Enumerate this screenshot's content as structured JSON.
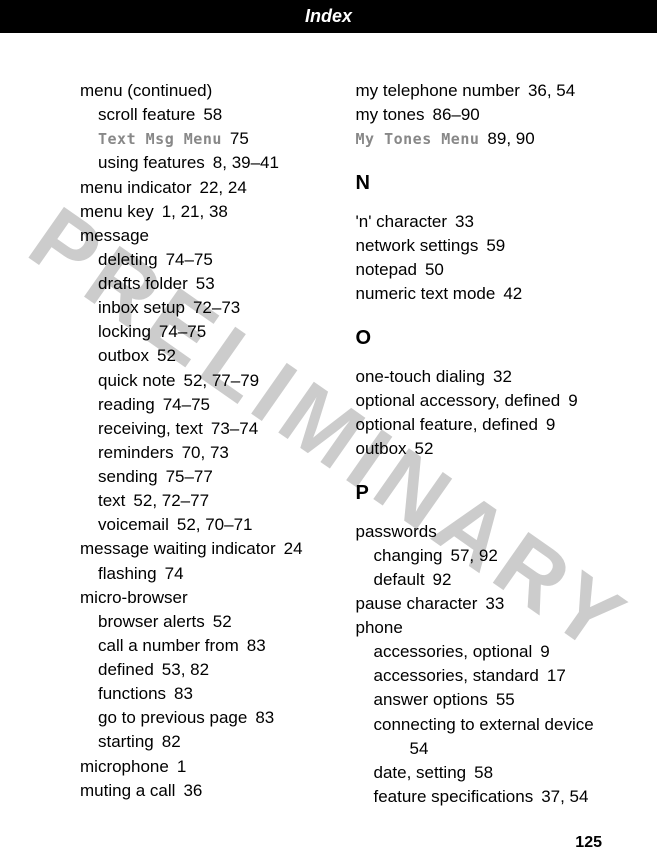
{
  "header": "Index",
  "watermark": "PRELIMINARY",
  "pageNumber": "125",
  "left": [
    {
      "text": "menu (continued)",
      "cls": ""
    },
    {
      "text": "scroll feature",
      "pages": "58",
      "cls": "sub"
    },
    {
      "special": "menu",
      "text": "Text Msg Menu",
      "pages": "75",
      "cls": "sub"
    },
    {
      "text": "using features",
      "pages": "8, 39–41",
      "cls": "sub"
    },
    {
      "text": "menu indicator",
      "pages": "22, 24",
      "cls": ""
    },
    {
      "text": "menu key",
      "pages": "1, 21, 38",
      "cls": ""
    },
    {
      "text": "message",
      "cls": ""
    },
    {
      "text": "deleting",
      "pages": "74–75",
      "cls": "sub"
    },
    {
      "text": "drafts folder",
      "pages": "53",
      "cls": "sub"
    },
    {
      "text": "inbox setup",
      "pages": "72–73",
      "cls": "sub"
    },
    {
      "text": "locking",
      "pages": "74–75",
      "cls": "sub"
    },
    {
      "text": "outbox",
      "pages": "52",
      "cls": "sub"
    },
    {
      "text": "quick note",
      "pages": "52, 77–79",
      "cls": "sub"
    },
    {
      "text": "reading",
      "pages": "74–75",
      "cls": "sub"
    },
    {
      "text": "receiving, text",
      "pages": "73–74",
      "cls": "sub"
    },
    {
      "text": "reminders",
      "pages": "70, 73",
      "cls": "sub"
    },
    {
      "text": "sending",
      "pages": "75–77",
      "cls": "sub"
    },
    {
      "text": "text",
      "pages": "52, 72–77",
      "cls": "sub"
    },
    {
      "text": "voicemail",
      "pages": "52, 70–71",
      "cls": "sub"
    },
    {
      "text": "message waiting indicator",
      "pages": "24",
      "cls": ""
    },
    {
      "text": "flashing",
      "pages": "74",
      "cls": "sub"
    },
    {
      "text": "micro-browser",
      "cls": ""
    },
    {
      "text": "browser alerts",
      "pages": "52",
      "cls": "sub"
    },
    {
      "text": "call a number from",
      "pages": "83",
      "cls": "sub"
    },
    {
      "text": "defined",
      "pages": "53, 82",
      "cls": "sub"
    },
    {
      "text": "functions",
      "pages": "83",
      "cls": "sub"
    },
    {
      "text": "go to previous page",
      "pages": "83",
      "cls": "sub"
    },
    {
      "text": "starting",
      "pages": "82",
      "cls": "sub"
    },
    {
      "text": "microphone",
      "pages": "1",
      "cls": ""
    },
    {
      "text": "muting a call",
      "pages": "36",
      "cls": ""
    }
  ],
  "right": [
    {
      "text": "my telephone number",
      "pages": "36, 54",
      "cls": ""
    },
    {
      "text": "my tones",
      "pages": "86–90",
      "cls": ""
    },
    {
      "special": "menu",
      "text": "My Tones Menu",
      "pages": "89, 90",
      "cls": ""
    },
    {
      "section": "N"
    },
    {
      "text": "'n' character",
      "pages": "33",
      "cls": ""
    },
    {
      "text": "network settings",
      "pages": "59",
      "cls": ""
    },
    {
      "text": "notepad",
      "pages": "50",
      "cls": ""
    },
    {
      "text": "numeric text mode",
      "pages": "42",
      "cls": ""
    },
    {
      "section": "O"
    },
    {
      "text": "one-touch dialing",
      "pages": "32",
      "cls": ""
    },
    {
      "text": "optional accessory, defined",
      "pages": "9",
      "cls": ""
    },
    {
      "text": "optional feature, defined",
      "pages": "9",
      "cls": ""
    },
    {
      "text": "outbox",
      "pages": "52",
      "cls": ""
    },
    {
      "section": "P"
    },
    {
      "text": "passwords",
      "cls": ""
    },
    {
      "text": "changing",
      "pages": "57, 92",
      "cls": "sub"
    },
    {
      "text": "default",
      "pages": "92",
      "cls": "sub"
    },
    {
      "text": "pause character",
      "pages": "33",
      "cls": ""
    },
    {
      "text": "phone",
      "cls": ""
    },
    {
      "text": "accessories, optional",
      "pages": "9",
      "cls": "sub"
    },
    {
      "text": "accessories, standard",
      "pages": "17",
      "cls": "sub"
    },
    {
      "text": "answer options",
      "pages": "55",
      "cls": "sub"
    },
    {
      "text": "connecting to external device",
      "cls": "sub"
    },
    {
      "text": "54",
      "cls": "subsub"
    },
    {
      "text": "date, setting",
      "pages": "58",
      "cls": "sub"
    },
    {
      "text": "feature specifications",
      "pages": "37, 54",
      "cls": "sub"
    }
  ]
}
